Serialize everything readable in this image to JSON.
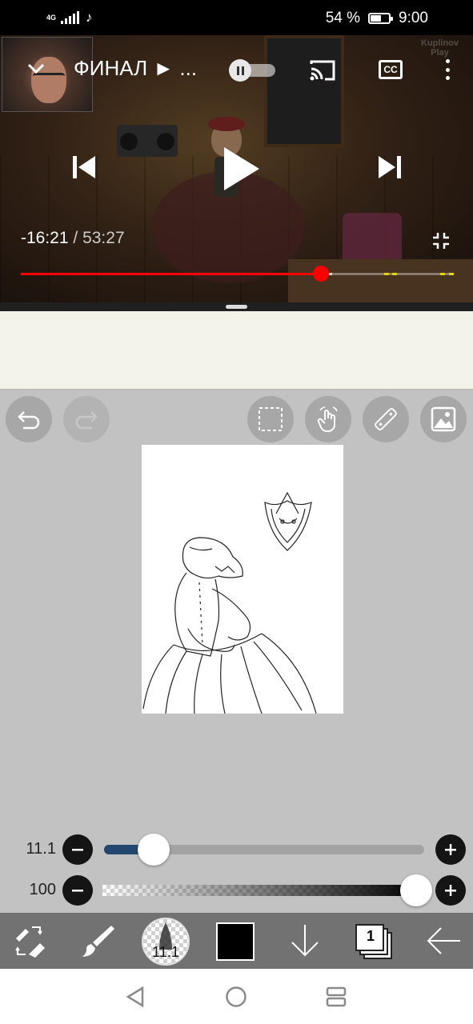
{
  "status_bar": {
    "network": "4G",
    "battery_percent": "54 %",
    "battery_level": 0.54,
    "time": "9:00",
    "notification_icon": "tiktok-icon"
  },
  "video_player": {
    "title": "ФИНАЛ ► ...",
    "watermark_line1": "Kuplinov",
    "watermark_line2": "Play",
    "elapsed_remaining": "-16:21",
    "separator": "/",
    "duration": "53:27",
    "progress": 0.695,
    "buffered": 0.72,
    "ad_markers": [
      0.84,
      0.86,
      0.97,
      0.99
    ],
    "cc_label": "CC",
    "colors": {
      "played": "#ff0000",
      "ad_marker": "#e6d800"
    }
  },
  "paint_app": {
    "brush_size_label": "11.1",
    "opacity_label": "100",
    "brush_size_level": 0.155,
    "opacity_level": 1.0,
    "brush_size_badge": "11.1",
    "layer_count": "1",
    "current_color": "#000000",
    "accent": "#24476f"
  }
}
